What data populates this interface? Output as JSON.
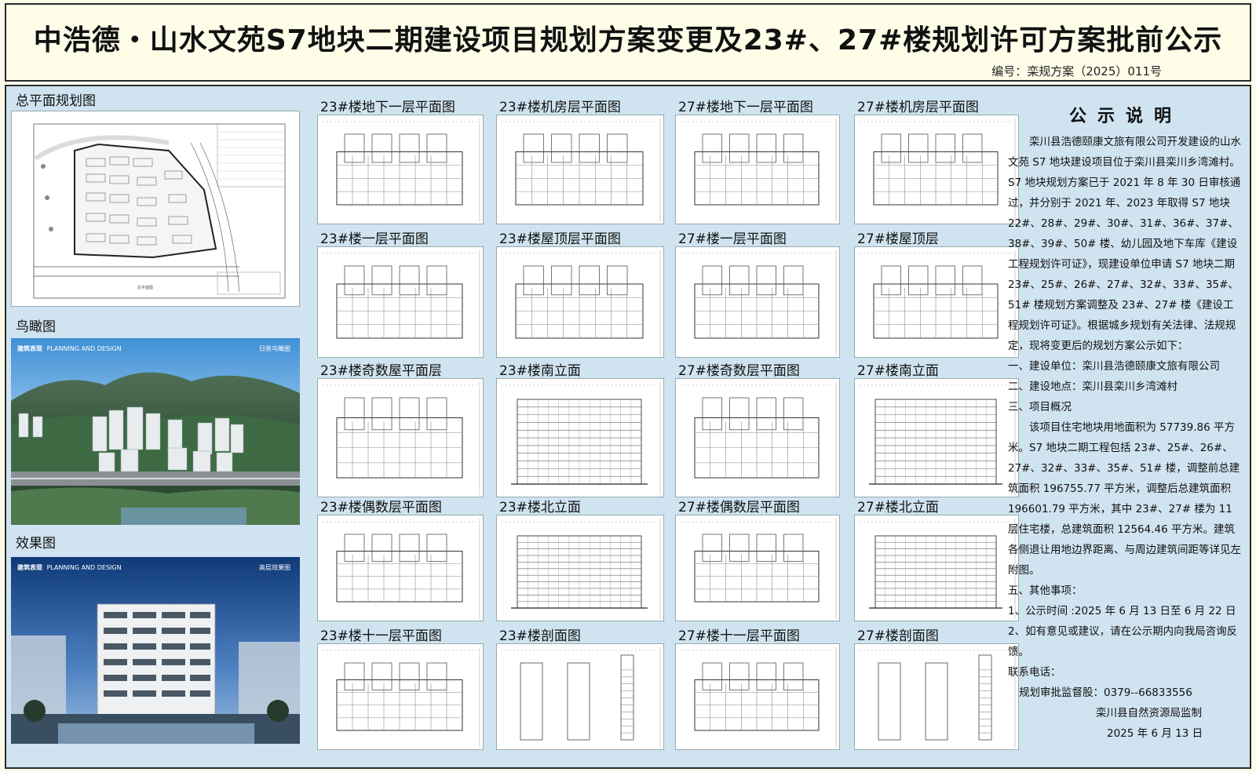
{
  "header": {
    "title": "中浩德・山水文苑S7地块二期建设项目规划方案变更及23#、27#楼规划许可方案批前公示",
    "doc_no": "编号：栾规方案（2025）011号"
  },
  "left": {
    "site_plan_label": "总平面规划图",
    "aerial_label": "鸟瞰图",
    "render_label": "效果图",
    "aerial_tag": "建筑表现",
    "aerial_tag_en": "PLANNING AND DESIGN",
    "aerial_tag_right": "日景鸟瞰图",
    "render_tag": "建筑表现",
    "render_tag_en": "PLANNING AND DESIGN",
    "render_tag_right": "高层效果图"
  },
  "drawings": [
    {
      "label": "23#楼地下一层平面图"
    },
    {
      "label": "23#楼机房层平面图"
    },
    {
      "label": "27#楼地下一层平面图"
    },
    {
      "label": "27#楼机房层平面图"
    },
    {
      "label": "23#楼一层平面图"
    },
    {
      "label": "23#楼屋顶层平面图"
    },
    {
      "label": "27#楼一层平面图"
    },
    {
      "label": "27#楼屋顶层"
    },
    {
      "label": "23#楼奇数屋平面层"
    },
    {
      "label": "23#楼南立面"
    },
    {
      "label": "27#楼奇数层平面图"
    },
    {
      "label": "27#楼南立面"
    },
    {
      "label": "23#楼偶数层平面图"
    },
    {
      "label": "23#楼北立面"
    },
    {
      "label": "27#楼偶数层平面图"
    },
    {
      "label": "27#楼北立面"
    },
    {
      "label": "23#楼十一层平面图"
    },
    {
      "label": "23#楼剖面图"
    },
    {
      "label": "27#楼十一层平面图"
    },
    {
      "label": "27#楼剖面图"
    }
  ],
  "notice": {
    "title": "公示说明",
    "p1": "栾川县浩德颐康文旅有限公司开发建设的山水文苑 S7 地块建设项目位于栾川县栾川乡湾滩村。S7 地块规划方案已于 2021 年 8 年 30 日审核通过，并分别于 2021 年、2023 年取得 S7 地块 22#、28#、29#、30#、31#、36#、37#、38#、39#、50# 楼、幼儿园及地下车库《建设工程规划许可证》，现建设单位申请 S7 地块二期 23#、25#、26#、27#、32#、33#、35#、51# 楼规划方案调整及 23#、27# 楼《建设工程规划许可证》。根据城乡规划有关法律、法规规定，现将变更后的规划方案公示如下：",
    "item1": "一、建设单位：栾川县浩德颐康文旅有限公司",
    "item2": "二、建设地点：栾川县栾川乡湾滩村",
    "item3": "三、项目概况",
    "p2": "该项目住宅地块用地面积为 57739.86 平方米。S7 地块二期工程包括 23#、25#、26#、27#、32#、33#、35#、51# 楼，调整前总建筑面积 196755.77 平方米，调整后总建筑面积 196601.79 平方米，其中 23#、27# 楼为 11 层住宅楼，总建筑面积 12564.46 平方米。建筑各侧退让用地边界距离、与周边建筑间距等详见左附图。",
    "item5": "五、其他事项：",
    "item5_1": "1、公示时间 :2025 年 6 月 13 日至 6 月 22 日",
    "item5_2": "2、如有意见或建议，请在公示期内向我局咨询反馈。",
    "contact": "联系电话：",
    "phone": "规划审批监督股：0379--66833556",
    "org": "栾川县自然资源局监制",
    "date": "2025 年 6 月 13 日"
  },
  "colors": {
    "panel_bg": "#cfe3f0",
    "header_bg": "#fdfde8",
    "border": "#2b2b2b"
  }
}
